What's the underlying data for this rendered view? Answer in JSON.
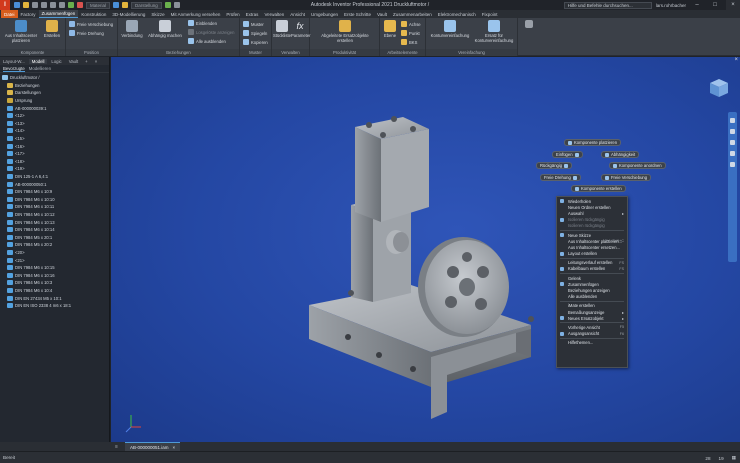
{
  "app": {
    "title": "Autodesk Inventor Professional 2021   Druckluftmotor /",
    "logo_letter": "I",
    "qat_dropdown_1": "Material",
    "qat_dropdown_2": "Darstellung",
    "search_placeholder": "Hilfe und Befehle durchsuchen...",
    "user": "lars.rohrbacher"
  },
  "ribbon_tabs": [
    "Datei",
    "Factory",
    "Zusammenfügen",
    "Konstruktion",
    "3D-Modellierung",
    "Skizze",
    "Mit Anmerkung versehen",
    "Prüfen",
    "Extras",
    "Verwalten",
    "Ansicht",
    "Umgebungen",
    "Erste Schritte",
    "Vault",
    "Zusammenarbeiten",
    "Elektromechanisch",
    "Fixpoint"
  ],
  "ribbon": {
    "komponente": {
      "label": "Komponente",
      "platzieren": "Aus Inhaltscenter platzieren",
      "erstellen": "Erstellen"
    },
    "position": {
      "label": "Position",
      "freie_verschiebung": "Freie Verschiebung",
      "freie_drehung": "Freie Drehung"
    },
    "beziehungen": {
      "label": "Beziehungen",
      "verbindung": "Verbindung",
      "abhaengig_machen": "Abhängig machen",
      "einblenden": "Einblenden",
      "losgeloest": "Losgelöste anzeigen",
      "alle_ausblenden": "Alle ausblenden"
    },
    "muster": {
      "label": "Muster",
      "muster": "Muster",
      "spiegeln": "Spiegeln",
      "kopieren": "Kopieren"
    },
    "verwalten": {
      "label": "Verwalten",
      "stueckliste": "Stückliste",
      "parameter": "Parameter"
    },
    "produktivitaet": {
      "label": "Produktivität",
      "ersatz": "Abgeleitete Ersatzobjekte erstellen"
    },
    "arbeitselemente": {
      "label": "Arbeitselemente",
      "ebene": "Ebene",
      "achse": "Achse",
      "punkt": "Punkt",
      "bks": "BKS"
    },
    "vereinfachung": {
      "label": "Vereinfachung",
      "konturen": "Konturvereinfachung",
      "ersatz_konturen": "Ersatz für Konturvereinfachung"
    }
  },
  "browser": {
    "tabs": [
      "Layout-W...",
      "Modell",
      "Logic",
      "Vault",
      "+",
      "×"
    ],
    "subtabs": {
      "bearbeiten": "Bevorzugte",
      "modellieren": "Modellieren"
    },
    "tree": [
      {
        "label": "Druckluftmotor /",
        "icon": "asm",
        "indent": 0
      },
      {
        "label": "Beziehungen",
        "icon": "folder",
        "indent": 1
      },
      {
        "label": "Darstellungen",
        "icon": "folder",
        "indent": 1
      },
      {
        "label": "Ursprung",
        "icon": "origin",
        "indent": 1
      },
      {
        "label": "AB-000000039:1",
        "icon": "part",
        "indent": 1
      },
      {
        "label": "<12>",
        "icon": "part",
        "indent": 1
      },
      {
        "label": "<13>",
        "icon": "part",
        "indent": 1
      },
      {
        "label": "<14>",
        "icon": "part",
        "indent": 1
      },
      {
        "label": "<15>",
        "icon": "part",
        "indent": 1
      },
      {
        "label": "<16>",
        "icon": "part",
        "indent": 1
      },
      {
        "label": "<17>",
        "icon": "part",
        "indent": 1
      },
      {
        "label": "<18>",
        "icon": "part",
        "indent": 1
      },
      {
        "label": "<19>",
        "icon": "part",
        "indent": 1
      },
      {
        "label": "DIN 125-1 A 6,4:1",
        "icon": "part",
        "indent": 1
      },
      {
        "label": "AB-000000050:1",
        "icon": "part",
        "indent": 1
      },
      {
        "label": "DIN 7984 M6 x 10:9",
        "icon": "part",
        "indent": 1
      },
      {
        "label": "DIN 7984 M6 x 10:10",
        "icon": "part",
        "indent": 1
      },
      {
        "label": "DIN 7984 M6 x 10:11",
        "icon": "part",
        "indent": 1
      },
      {
        "label": "DIN 7984 M6 x 10:12",
        "icon": "part",
        "indent": 1
      },
      {
        "label": "DIN 7984 M6 x 10:13",
        "icon": "part",
        "indent": 1
      },
      {
        "label": "DIN 7984 M6 x 10:14",
        "icon": "part",
        "indent": 1
      },
      {
        "label": "DIN 7984 M5 x 20:1",
        "icon": "part",
        "indent": 1
      },
      {
        "label": "DIN 7984 M5 x 20:2",
        "icon": "part",
        "indent": 1
      },
      {
        "label": "<20>",
        "icon": "part",
        "indent": 1
      },
      {
        "label": "<21>",
        "icon": "part",
        "indent": 1
      },
      {
        "label": "DIN 7984 M6 x 10:15",
        "icon": "part",
        "indent": 1
      },
      {
        "label": "DIN 7984 M6 x 10:16",
        "icon": "part",
        "indent": 1
      },
      {
        "label": "DIN 7984 M6 x 10:3",
        "icon": "part",
        "indent": 1
      },
      {
        "label": "DIN 7984 M6 x 10:4",
        "icon": "part",
        "indent": 1
      },
      {
        "label": "DIN EN 27434 M5 x 10:1",
        "icon": "part",
        "indent": 1
      },
      {
        "label": "DIN EN ISO 2338 4 m6 x 18:1",
        "icon": "part",
        "indent": 1
      }
    ]
  },
  "marking_menu": {
    "komponente_platzieren": "Komponente platzieren",
    "einfuegen": "Einfügen",
    "abhaengigkeit": "Abhängigkeit",
    "rueckgaengig": "Rückgängig",
    "komponente_anordnen": "Komponente anordnen",
    "freie_drehung": "Freie Drehung",
    "freie_verschiebung": "Freie Verschiebung",
    "komponente_erstellen": "Komponente erstellen"
  },
  "context_menu": [
    {
      "label": "Wiederholen",
      "type": "item"
    },
    {
      "label": "Neuen Ordner erstellen",
      "type": "item"
    },
    {
      "label": "Auswahl",
      "type": "item",
      "arrow": "▸"
    },
    {
      "label": "Isolieren rückgängig",
      "type": "dis"
    },
    {
      "label": "Isolieren rückgängig",
      "type": "dis"
    },
    {
      "type": "sep"
    },
    {
      "label": "Neue Skizze",
      "type": "item"
    },
    {
      "label": "Aus Inhaltscenter platzieren...",
      "type": "item",
      "shortcut": "Ctrl+Shift+C"
    },
    {
      "label": "Aus Inhaltscenter ersetzen...",
      "type": "item"
    },
    {
      "label": "Layout erstellen",
      "type": "item"
    },
    {
      "type": "sep"
    },
    {
      "label": "Leitungsverlauf erstellen",
      "type": "item",
      "shortcut": "FS"
    },
    {
      "label": "Kabelbaum erstellen",
      "type": "item",
      "shortcut": "FS"
    },
    {
      "type": "sep"
    },
    {
      "label": "Gelenk",
      "type": "item"
    },
    {
      "label": "Zusammenfügen",
      "type": "item"
    },
    {
      "label": "Beziehungen anzeigen",
      "type": "item"
    },
    {
      "label": "Alle ausblenden",
      "type": "item"
    },
    {
      "type": "sep"
    },
    {
      "label": "iMate erstellen",
      "type": "item"
    },
    {
      "label": "Bemaßungsanzeige",
      "type": "item",
      "arrow": "▸"
    },
    {
      "label": "Neues Ersatzobjekt",
      "type": "item",
      "arrow": "▸"
    },
    {
      "type": "sep"
    },
    {
      "label": "Vorherige Ansicht",
      "type": "item",
      "shortcut": "F5"
    },
    {
      "label": "Ausgangsansicht",
      "type": "item",
      "shortcut": "F6"
    },
    {
      "type": "sep"
    },
    {
      "label": "Hilfethemen...",
      "type": "item"
    }
  ],
  "doc_tab": {
    "label": "AB-000000051.iam",
    "close": "×"
  },
  "status": {
    "left": "Bereit",
    "count1": "28",
    "count2": "19"
  },
  "colors": {
    "viewport_bg": "#2447a3",
    "accent": "#4f9ad6",
    "file_tab": "#d75e1d"
  }
}
